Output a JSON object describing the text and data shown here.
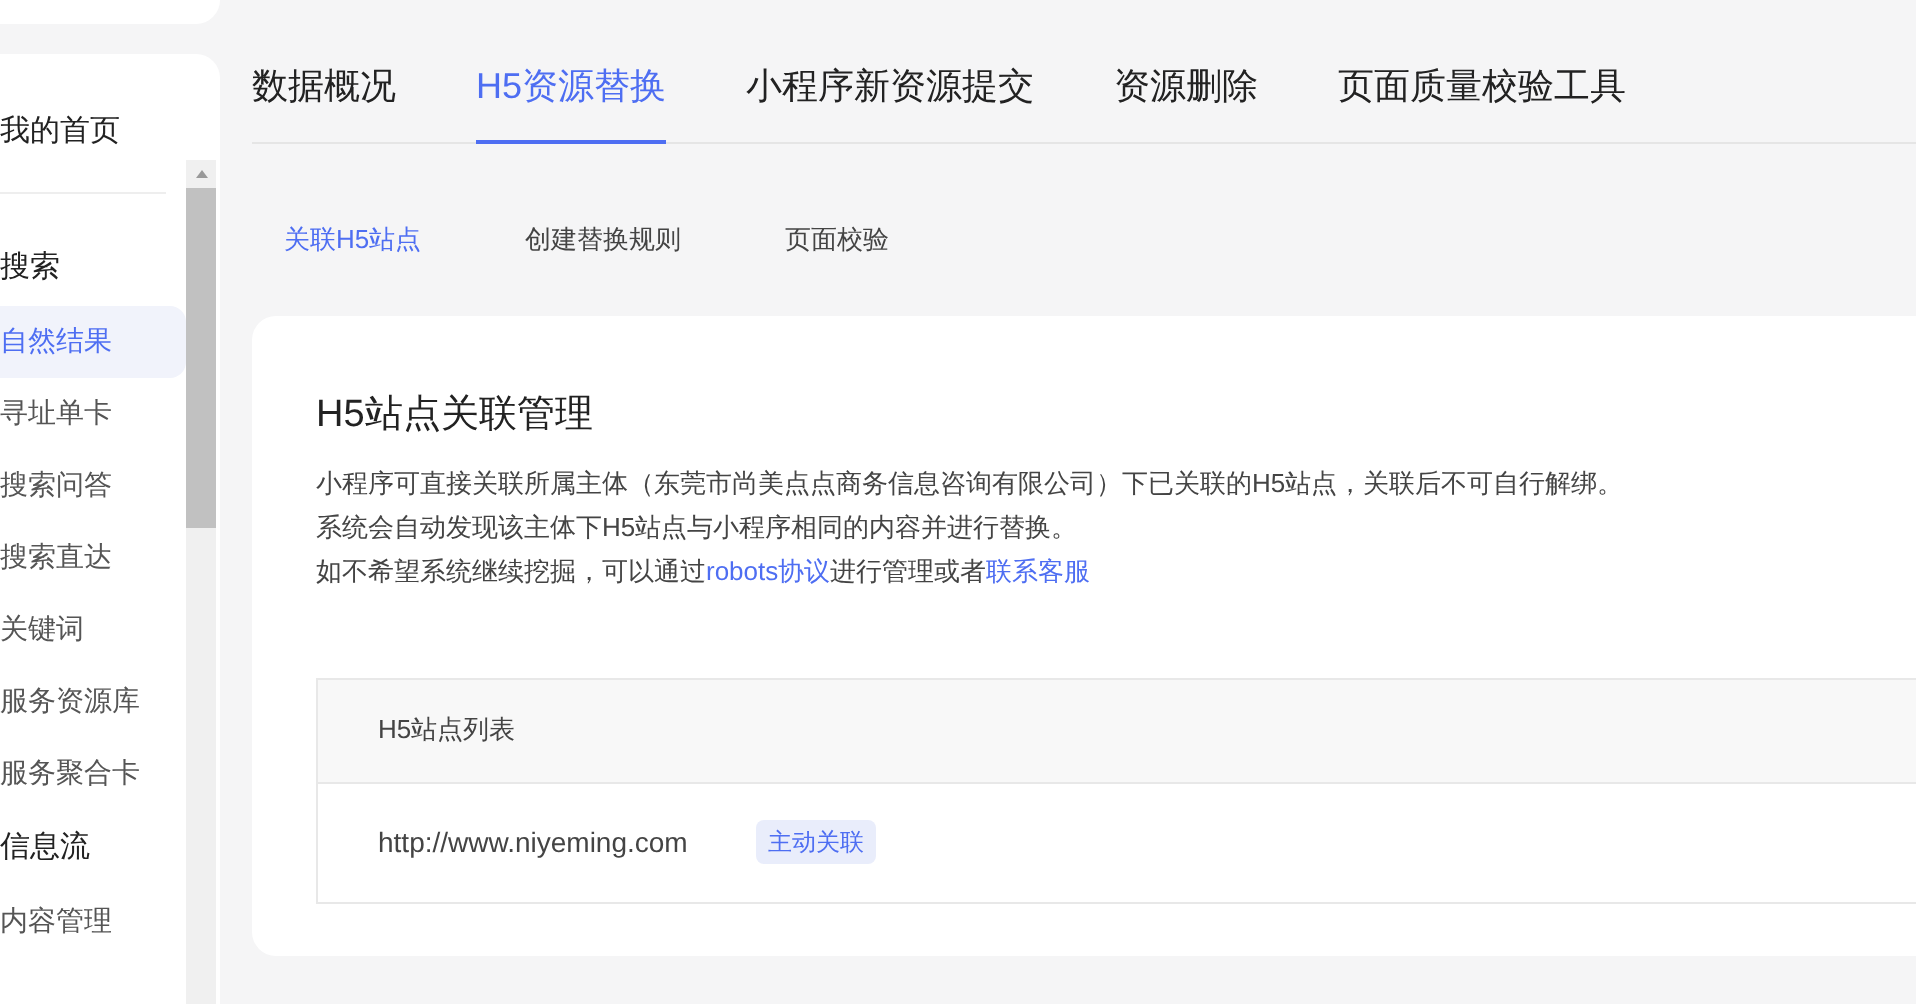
{
  "sidebar": {
    "items": [
      {
        "kind": "link",
        "label": "我的首页",
        "selected": false
      },
      {
        "kind": "group",
        "label": "搜索",
        "children": [
          {
            "label": "自然结果",
            "selected": true
          },
          {
            "label": "寻址单卡",
            "selected": false
          },
          {
            "label": "搜索问答",
            "selected": false
          },
          {
            "label": "搜索直达",
            "selected": false
          },
          {
            "label": "关键词",
            "selected": false
          },
          {
            "label": "服务资源库",
            "selected": false
          },
          {
            "label": "服务聚合卡",
            "selected": false
          }
        ]
      },
      {
        "kind": "group",
        "label": "信息流",
        "children": [
          {
            "label": "内容管理",
            "selected": false
          }
        ]
      }
    ]
  },
  "tabs": [
    {
      "label": "数据概况",
      "selected": false
    },
    {
      "label": "H5资源替换",
      "selected": true
    },
    {
      "label": "小程序新资源提交",
      "selected": false
    },
    {
      "label": "资源删除",
      "selected": false
    },
    {
      "label": "页面质量校验工具",
      "selected": false
    }
  ],
  "subtabs": [
    {
      "label": "关联H5站点",
      "selected": true
    },
    {
      "label": "创建替换规则",
      "selected": false
    },
    {
      "label": "页面校验",
      "selected": false
    }
  ],
  "card": {
    "title": "H5站点关联管理",
    "lines": [
      [
        {
          "text": "小程序可直接关联所属主体（东莞市尚美点点商务信息咨询有限公司）下已关联的H5站点，关联后不可自行解绑。",
          "kind": "text"
        }
      ],
      [
        {
          "text": "系统会自动发现该主体下H5站点与小程序相同的内容并进行替换。",
          "kind": "text"
        }
      ],
      [
        {
          "text": "如不希望系统继续挖掘，可以通过",
          "kind": "text"
        },
        {
          "text": "robots协议",
          "kind": "link"
        },
        {
          "text": "进行管理或者",
          "kind": "text"
        },
        {
          "text": "联系客服",
          "kind": "link"
        }
      ]
    ],
    "table": {
      "columns": [
        "H5站点列表"
      ],
      "rows": [
        {
          "url": "http://www.niyeming.com",
          "tag": "主动关联"
        }
      ]
    }
  }
}
